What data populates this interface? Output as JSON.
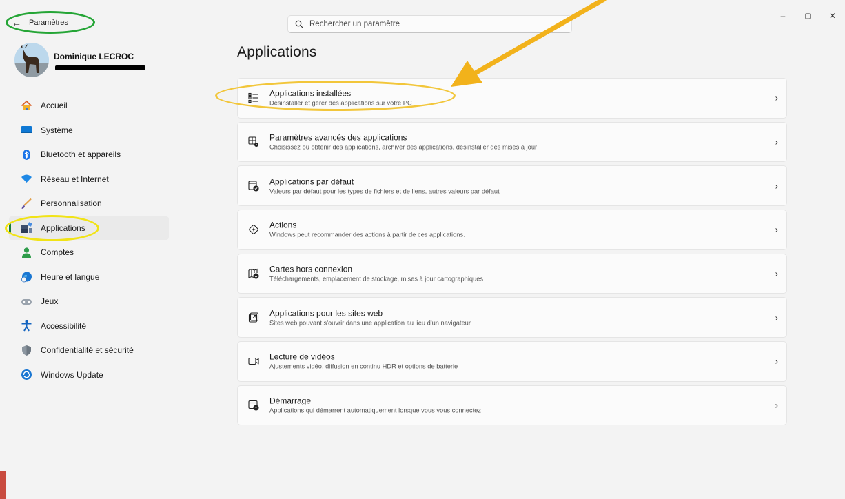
{
  "window": {
    "title": "Paramètres",
    "controls": [
      "–",
      "▢",
      "✕"
    ]
  },
  "search": {
    "placeholder": "Rechercher un paramètre"
  },
  "profile": {
    "name": "Dominique LECROC"
  },
  "sidebar": {
    "items": [
      {
        "label": "Accueil",
        "icon": "home-icon"
      },
      {
        "label": "Système",
        "icon": "system-icon"
      },
      {
        "label": "Bluetooth et appareils",
        "icon": "bluetooth-icon"
      },
      {
        "label": "Réseau et Internet",
        "icon": "wifi-icon"
      },
      {
        "label": "Personnalisation",
        "icon": "brush-icon"
      },
      {
        "label": "Applications",
        "icon": "apps-icon",
        "active": true
      },
      {
        "label": "Comptes",
        "icon": "account-icon"
      },
      {
        "label": "Heure et langue",
        "icon": "globe-clock-icon"
      },
      {
        "label": "Jeux",
        "icon": "gamepad-icon"
      },
      {
        "label": "Accessibilité",
        "icon": "accessibility-icon"
      },
      {
        "label": "Confidentialité et sécurité",
        "icon": "shield-icon"
      },
      {
        "label": "Windows Update",
        "icon": "update-icon"
      }
    ]
  },
  "main": {
    "title": "Applications",
    "cards": [
      {
        "title": "Applications installées",
        "desc": "Désinstaller et gérer des applications sur votre PC",
        "icon": "list-icon"
      },
      {
        "title": "Paramètres avancés des applications",
        "desc": "Choisissez où obtenir des applications, archiver des applications, désinstaller des mises à jour",
        "icon": "app-gear-icon"
      },
      {
        "title": "Applications par défaut",
        "desc": "Valeurs par défaut pour les types de fichiers et de liens, autres valeurs par défaut",
        "icon": "default-apps-icon"
      },
      {
        "title": "Actions",
        "desc": "Windows peut recommander des actions à partir de ces applications.",
        "icon": "actions-icon"
      },
      {
        "title": "Cartes hors connexion",
        "desc": "Téléchargements, emplacement de stockage, mises à jour cartographiques",
        "icon": "map-icon"
      },
      {
        "title": "Applications pour les sites web",
        "desc": "Sites web pouvant s'ouvrir dans une application au lieu d'un navigateur",
        "icon": "open-in-app-icon"
      },
      {
        "title": "Lecture de vidéos",
        "desc": "Ajustements vidéo, diffusion en continu HDR et options de batterie",
        "icon": "video-icon"
      },
      {
        "title": "Démarrage",
        "desc": "Applications qui démarrent automatiquement lorsque vous vous connectez",
        "icon": "startup-icon"
      }
    ]
  },
  "colors": {
    "accent": "#0067c0",
    "active_indicator": "#1a7f37",
    "annotation_green": "#25a536",
    "annotation_yellow": "#f1e316",
    "annotation_orange": "#f2c63a"
  }
}
